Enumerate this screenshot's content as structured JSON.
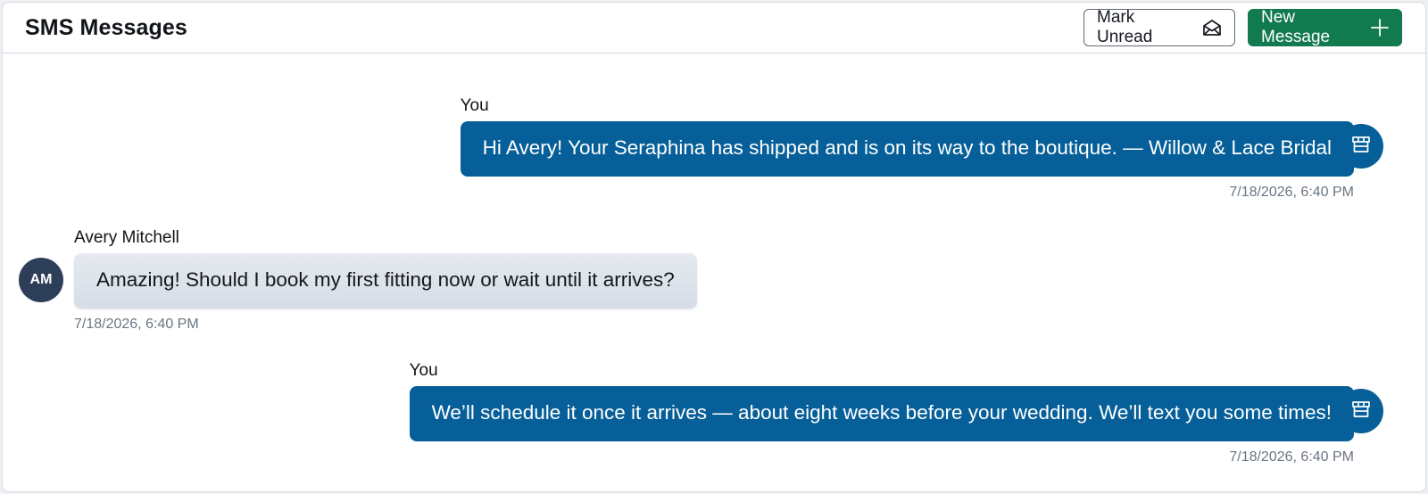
{
  "header": {
    "title": "SMS Messages",
    "mark_unread_label": "Mark Unread",
    "new_message_label": "New Message"
  },
  "colors": {
    "outgoing_bubble": "#065f98",
    "incoming_bubble": "#dde2ea",
    "primary_button": "#117a4f",
    "initials_avatar": "#2d3f58"
  },
  "messages": [
    {
      "direction": "outgoing",
      "sender": "You",
      "text": "Hi Avery! Your Seraphina has shipped and is on its way to the boutique. — Willow & Lace Bridal",
      "timestamp": "7/18/2026, 6:40 PM",
      "avatar_icon": "store-icon"
    },
    {
      "direction": "incoming",
      "sender": "Avery Mitchell",
      "text": "Amazing! Should I book my first fitting now or wait until it arrives?",
      "timestamp": "7/18/2026, 6:40 PM",
      "avatar_initials": "AM"
    },
    {
      "direction": "outgoing",
      "sender": "You",
      "text": "We’ll schedule it once it arrives — about eight weeks before your wedding. We’ll text you some times!",
      "timestamp": "7/18/2026, 6:40 PM",
      "avatar_icon": "store-icon"
    }
  ]
}
